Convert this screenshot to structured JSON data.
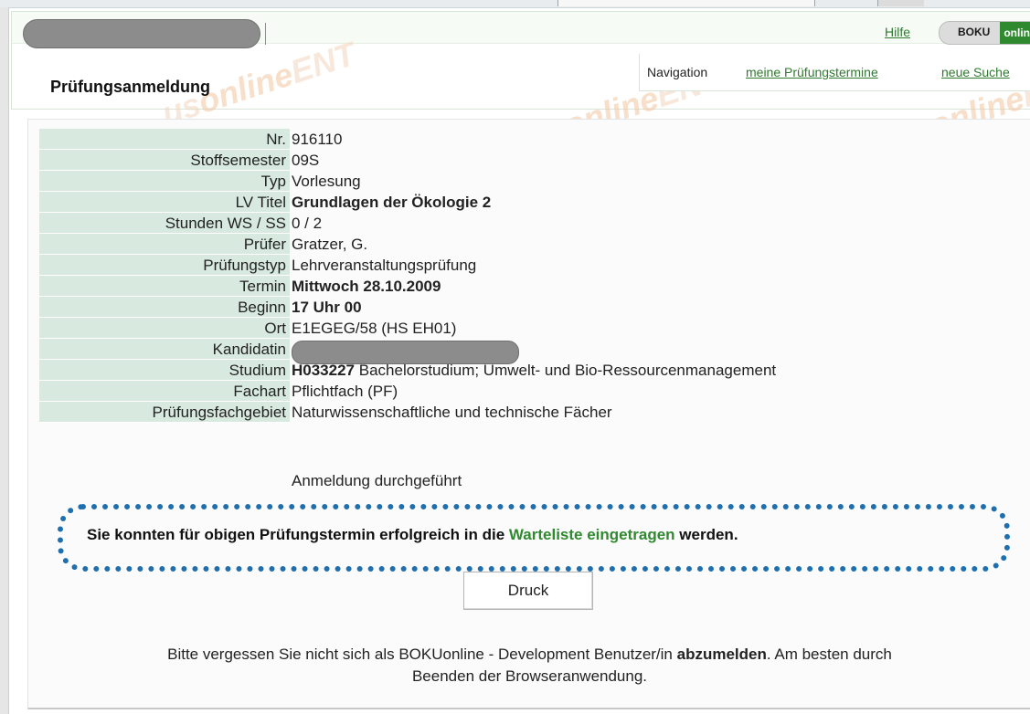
{
  "header": {
    "help_link": "Hilfe",
    "brand": {
      "boku": "BOKU",
      "online": "online"
    },
    "page_title": "Prüfungsanmeldung",
    "watermark": {
      "prefix": "us",
      "online": "online",
      "suffix": "ENT"
    },
    "navigation": {
      "label": "Navigation",
      "links": [
        {
          "label": "meine Prüfungstermine"
        },
        {
          "label": "neue Suche"
        }
      ]
    }
  },
  "exam": {
    "rows": [
      {
        "label": "Nr.",
        "value": "916110",
        "bold": false
      },
      {
        "label": "Stoffsemester",
        "value": "09S",
        "bold": false
      },
      {
        "label": "Typ",
        "value": "Vorlesung",
        "bold": false
      },
      {
        "label": "LV Titel",
        "value": "Grundlagen der Ökologie 2",
        "bold": true
      },
      {
        "label": "Stunden WS / SS",
        "value": "0 / 2",
        "bold": false
      },
      {
        "label": "Prüfer",
        "value": "Gratzer, G.",
        "bold": false
      },
      {
        "label": "Prüfungstyp",
        "value": "Lehrveranstaltungsprüfung",
        "bold": false
      },
      {
        "label": "Termin",
        "value": "Mittwoch 28.10.2009",
        "bold": true
      },
      {
        "label": "Beginn",
        "value": "17 Uhr 00",
        "bold": true
      },
      {
        "label": "Ort",
        "value": "E1EGEG/58 (HS EH01)",
        "bold": false
      },
      {
        "label": "Kandidatin",
        "value": "",
        "bold": false
      },
      {
        "label": "Studium",
        "value_bold": "H033227",
        "value": " Bachelorstudium; Umwelt- und Bio-Ressourcenmanagement",
        "bold": false
      },
      {
        "label": "Fachart",
        "value": "Pflichtfach (PF)",
        "bold": false
      },
      {
        "label": "Prüfungsfachgebiet",
        "value": "Naturwissenschaftliche und technische Fächer",
        "bold": false
      }
    ],
    "status": "Anmeldung durchgeführt"
  },
  "waitlist_message": {
    "before": "Sie konnten für obigen Prüfungstermin erfolgreich in die ",
    "highlight": "Warteliste eingetragen",
    "after": " werden."
  },
  "actions": {
    "print_label": "Druck"
  },
  "footer": {
    "line1_before": "Bitte vergessen Sie nicht sich als BOKUonline - Development Benutzer/in ",
    "line1_bold": "abzumelden",
    "line1_after": ". Am besten durch",
    "line2": "Beenden der Browseranwendung."
  },
  "colors": {
    "label_bg": "#d8eadf",
    "link_green": "#2f7a2f",
    "highlight_green": "#2f8a2f",
    "dotted_border": "#1d6fb0"
  }
}
